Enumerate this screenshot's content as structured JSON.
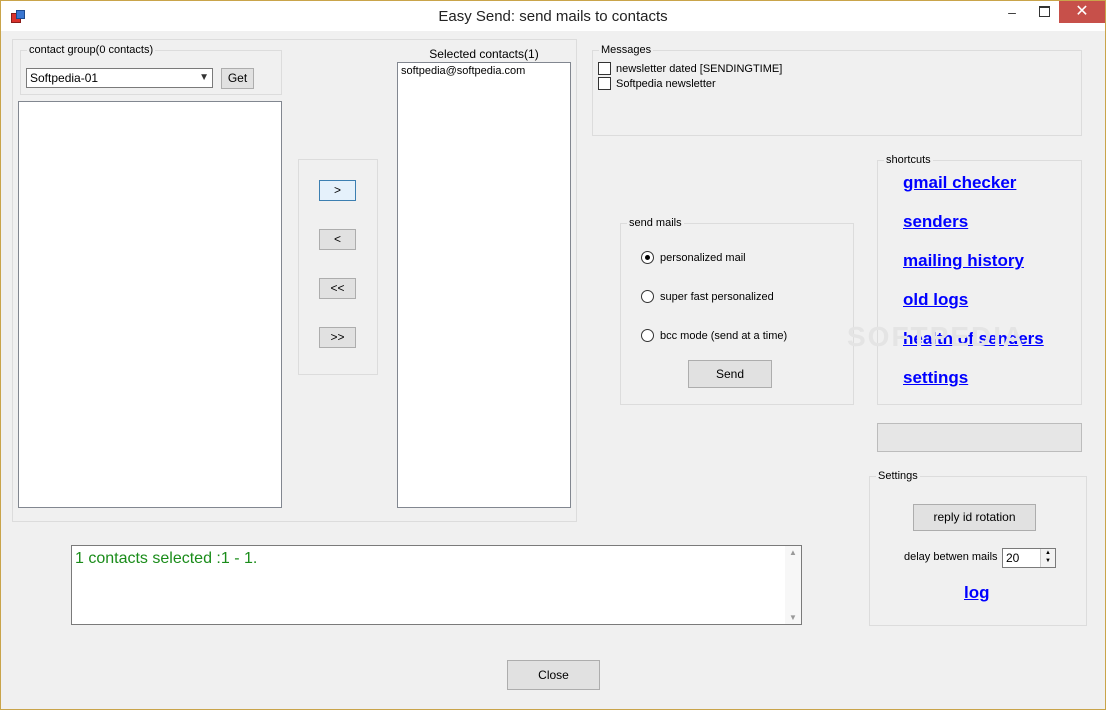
{
  "window": {
    "title": "Easy Send: send mails to contacts"
  },
  "contacts": {
    "group_legend": "contact group(0 contacts)",
    "group_selected": "Softpedia-01",
    "get_label": "Get",
    "selected_header": "Selected contacts(1)",
    "selected_items": [
      "softpedia@softpedia.com"
    ],
    "move_right": ">",
    "move_left": "<",
    "move_all_left": "<<",
    "move_all_right": ">>"
  },
  "messages": {
    "legend": "Messages",
    "items": [
      {
        "label": "newsletter dated [SENDINGTIME]",
        "checked": false
      },
      {
        "label": "Softpedia newsletter",
        "checked": false
      }
    ]
  },
  "send_mails": {
    "legend": "send mails",
    "options": [
      {
        "label": "personalized mail",
        "selected": true
      },
      {
        "label": "super fast personalized",
        "selected": false
      },
      {
        "label": "bcc mode (send at a time)",
        "selected": false
      }
    ],
    "send_label": "Send"
  },
  "shortcuts": {
    "legend": "shortcuts",
    "links": [
      "gmail checker",
      "senders",
      "mailing history",
      "old logs",
      "health of senders",
      "settings"
    ]
  },
  "settings": {
    "legend": "Settings",
    "reply_rotation_label": "reply id rotation",
    "delay_label": "delay betwen mails",
    "delay_value": "20",
    "log_label": "log"
  },
  "status": {
    "text": "1 contacts selected :1 - 1."
  },
  "footer": {
    "close_label": "Close"
  },
  "watermark": {
    "text": "SOFTPEDIA"
  },
  "colors": {
    "link": "#0000ff",
    "status_text": "#1a8c1a",
    "close_button": "#c7504a"
  }
}
